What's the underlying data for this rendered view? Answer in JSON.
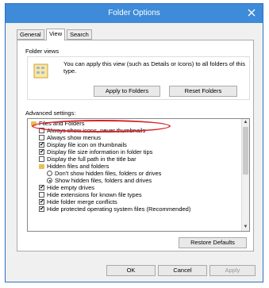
{
  "window": {
    "title": "Folder Options"
  },
  "tabs": [
    {
      "label": "General"
    },
    {
      "label": "View"
    },
    {
      "label": "Search"
    }
  ],
  "folder_views": {
    "title": "Folder views",
    "description": "You can apply this view (such as Details or Icons) to all folders of this type.",
    "apply_button": "Apply to Folders",
    "reset_button": "Reset Folders"
  },
  "advanced": {
    "label": "Advanced settings:",
    "items": [
      {
        "text": "Files and Folders",
        "kind": "folder"
      },
      {
        "text": "Always show icons, never thumbnails",
        "kind": "checkbox",
        "checked": false
      },
      {
        "text": "Always show menus",
        "kind": "checkbox",
        "checked": false
      },
      {
        "text": "Display file icon on thumbnails",
        "kind": "checkbox",
        "checked": true
      },
      {
        "text": "Display file size information in folder tips",
        "kind": "checkbox",
        "checked": true
      },
      {
        "text": "Display the full path in the title bar",
        "kind": "checkbox",
        "checked": false
      },
      {
        "text": "Hidden files and folders",
        "kind": "folder"
      },
      {
        "text": "Don't show hidden files, folders or drives",
        "kind": "radio",
        "checked": false
      },
      {
        "text": "Show hidden files, folders and drives",
        "kind": "radio",
        "checked": true
      },
      {
        "text": "Hide empty drives",
        "kind": "checkbox",
        "checked": true
      },
      {
        "text": "Hide extensions for known file types",
        "kind": "checkbox",
        "checked": false
      },
      {
        "text": "Hide folder merge conflicts",
        "kind": "checkbox",
        "checked": true
      },
      {
        "text": "Hide protected operating system files (Recommended)",
        "kind": "checkbox",
        "checked": true
      }
    ]
  },
  "restore_button": "Restore Defaults",
  "footer": {
    "ok": "OK",
    "cancel": "Cancel",
    "apply": "Apply"
  },
  "annotation_color": "#d8232a",
  "titlebar_color": "#3e8bd9"
}
